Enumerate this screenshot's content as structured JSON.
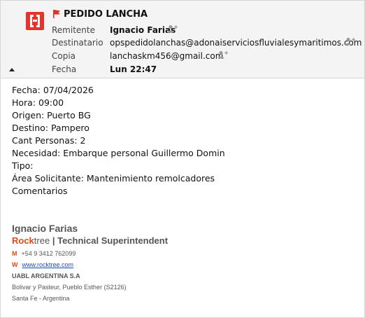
{
  "header": {
    "subject": "PEDIDO LANCHA",
    "fields": [
      {
        "label": "Remitente",
        "value": "Ignacio Farias"
      },
      {
        "label": "Destinatario",
        "value": "opspedidolanchas@adonaiserviciosfluvialesymaritimos.com"
      },
      {
        "label": "Copia",
        "value": "lanchaskm456@gmail.com"
      },
      {
        "label": "Fecha",
        "value": "Lun 22:47"
      }
    ]
  },
  "body": {
    "lines": [
      "Fecha: 07/04/2026",
      "Hora: 09:00",
      "Origen: Puerto BG",
      "Destino: Pampero",
      "Cant Personas: 2",
      "Necesidad: Embarque personal Guillermo Domin",
      "Tipo:",
      "Área Solicitante: Mantenimiento remolcadores",
      "Comentarios"
    ]
  },
  "signature": {
    "name": "Ignacio Farias",
    "brand_rock": "Rock",
    "brand_tree": "tree",
    "separator": "|",
    "title": "Technical Superintendent",
    "phone_letter": "M",
    "phone": "+54 9 3412 762099",
    "web_letter": "W",
    "web": "www.rocktree.com",
    "company": "UABL ARGENTINA S.A",
    "address1": "Bolivar y Pasteur, Pueblo Esther (S2126)",
    "address2": "Santa Fe - Argentina"
  },
  "colors": {
    "logo": "#e8322c",
    "flag": "#d9322b",
    "brand_orange": "#e04a1a",
    "link": "#1a4fb5"
  },
  "icons": {
    "logo": "app-logo-icon",
    "flag": "flag-icon",
    "contact": "add-contact-icon",
    "collapse": "collapse-arrow-icon"
  }
}
